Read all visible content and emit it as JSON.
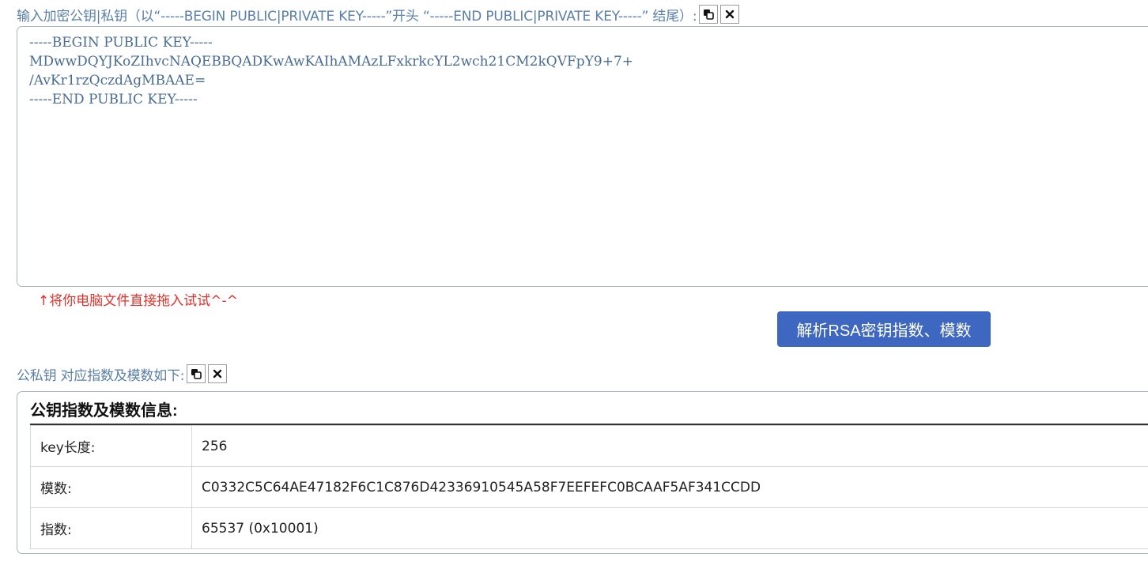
{
  "input_section": {
    "label": "输入加密公钥|私钥（以“-----BEGIN PUBLIC|PRIVATE KEY-----”开头 “-----END PUBLIC|PRIVATE KEY-----” 结尾）:",
    "key_text": "-----BEGIN PUBLIC KEY-----\nMDwwDQYJKoZIhvcNAQEBBQADKwAwKAIhAMAzLFxkrkcYL2wch21CM2kQVFpY9+7+\n/AvKr1rzQczdAgMBAAE=\n-----END PUBLIC KEY-----",
    "copy_icon": "copy-icon",
    "clear_icon": "close-icon"
  },
  "drag_hint": "↑将你电脑文件直接拖入试试^-^",
  "parse_button_label": "解析RSA密钥指数、模数",
  "result_section": {
    "label": "公私钥 对应指数及模数如下:",
    "title": "公钥指数及模数信息:",
    "rows": [
      {
        "key": "key长度:",
        "value": "256"
      },
      {
        "key": "模数:",
        "value": "C0332C5C64AE47182F6C1C876D42336910545A58F7EEFEFC0BCAAF5AF341CCDD"
      },
      {
        "key": "指数:",
        "value": "65537 (0x10001)"
      }
    ]
  },
  "colors": {
    "label": "#5a7fa8",
    "key_text": "#4a6d94",
    "hint": "#e0322a",
    "button": "#3d67c0"
  }
}
